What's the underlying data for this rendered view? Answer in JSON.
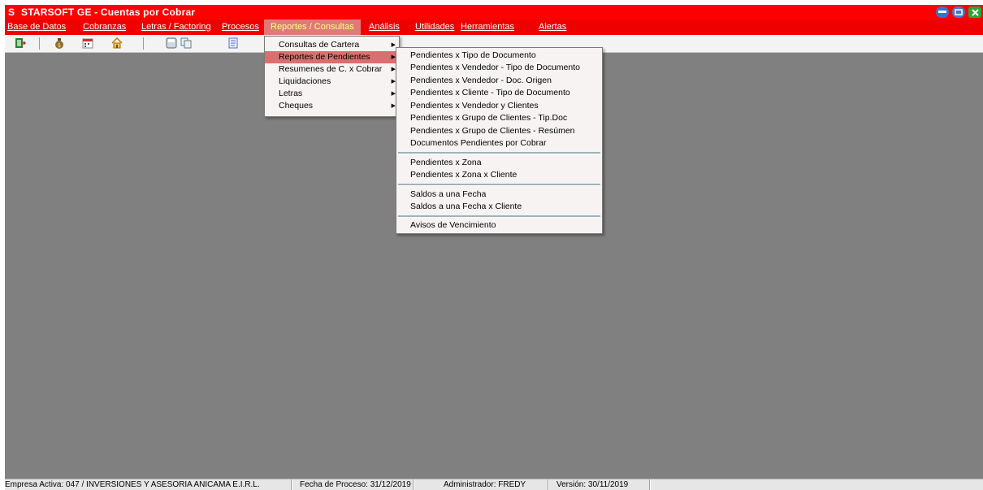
{
  "window": {
    "title": "STARSOFT GE - Cuentas por Cobrar",
    "logo": "S"
  },
  "menubar": [
    {
      "label": "Base de Datos"
    },
    {
      "label": "Cobranzas"
    },
    {
      "label": "Letras / Factoring"
    },
    {
      "label": "Procesos"
    },
    {
      "label": "Reportes / Consultas"
    },
    {
      "label": "Análisis"
    },
    {
      "label": "Utilidades"
    },
    {
      "label": "Herramientas"
    },
    {
      "label": "Alertas"
    }
  ],
  "reportes_menu": [
    {
      "label": "Consultas de Cartera"
    },
    {
      "label": "Reportes de Pendientes"
    },
    {
      "label": "Resumenes de C. x Cobrar"
    },
    {
      "label": "Liquidaciones"
    },
    {
      "label": "Letras"
    },
    {
      "label": "Cheques"
    }
  ],
  "pendientes_menu": [
    {
      "label": "Pendientes x Tipo de Documento"
    },
    {
      "label": "Pendientes x Vendedor - Tipo de Documento"
    },
    {
      "label": "Pendientes x Vendedor - Doc. Origen"
    },
    {
      "label": "Pendientes x Cliente - Tipo de Documento"
    },
    {
      "label": "Pendientes x Vendedor y Clientes"
    },
    {
      "label": "Pendientes x Grupo de Clientes - Tip.Doc"
    },
    {
      "label": "Pendientes x Grupo de Clientes - Resúmen"
    },
    {
      "label": "Documentos Pendientes por Cobrar"
    },
    {
      "label": "Pendientes x Zona"
    },
    {
      "label": "Pendientes x Zona x Cliente"
    },
    {
      "label": "Saldos a una Fecha"
    },
    {
      "label": "Saldos a una Fecha x Cliente"
    },
    {
      "label": "Avisos de Vencimiento"
    }
  ],
  "statusbar": {
    "empresa": "Empresa Activa: 047 / INVERSIONES Y ASESORIA ANICAMA E.I.R.L.",
    "fecha": "Fecha de Proceso: 31/12/2019",
    "usuario": "Administrador: FREDY",
    "version": "Versión: 30/11/2019"
  },
  "toolbar_icons": [
    "exit-icon",
    "money-bag-icon",
    "calendar-icon",
    "home-icon",
    "save-icon",
    "copy-icon",
    "notes-icon"
  ],
  "colors": {
    "titlebar": "#ff0000",
    "menubar": "#ee0000",
    "workspace": "#808080",
    "highlight": "#d9706f",
    "active_menu_text": "#ffff80"
  }
}
